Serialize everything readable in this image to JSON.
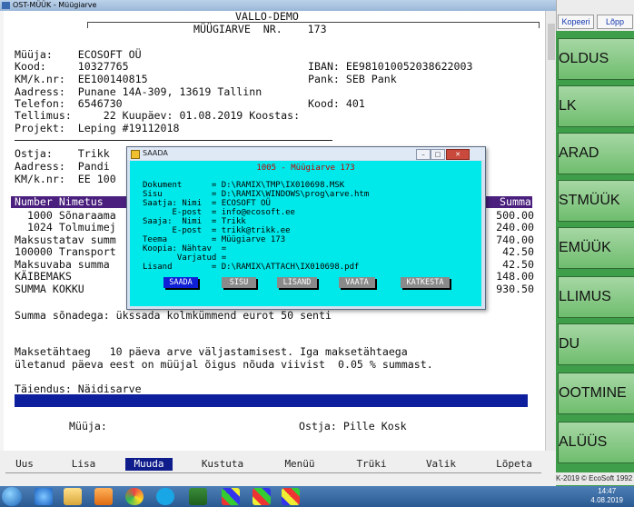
{
  "window": {
    "title": "OST-MÜÜK - Müügiarve"
  },
  "document": {
    "company_title": "VALLO-DEMO",
    "invoice_title": "MÜÜGIARVE  NR.    173",
    "seller": {
      "muuja": "Müüja:    ECOSOFT OÜ",
      "kood": "Kood:     10327765",
      "kmk": "KM/k.nr:  EE100140815",
      "aadress": "Aadress:  Punane 14A-309, 13619 Tallinn",
      "telefon": "Telefon:  6546730",
      "tellimus": "Tellimus:     22 Kuupäev: 01.08.2019 Koostas:",
      "projekt": "Projekt:  Leping #19112018"
    },
    "bank": {
      "iban": "IBAN: EE981010052038622003",
      "pank": "Pank: SEB Pank",
      "kood": "Kood: 401"
    },
    "buyer": {
      "ostja": "Ostja:    Trikk",
      "aadress": "Aadress:  Pandi",
      "kmk": "KM/k.nr:  EE 100"
    },
    "table_header_left": "Number Nimetus",
    "table_header_right": "Summa",
    "rows_left": [
      "  1000 Sõnaraama",
      "  1024 Tolmuimej",
      "Maksustatav summ",
      "100000 Transport",
      "Maksuvaba summa",
      "KÄIBEMAKS",
      "SUMMA KOKKU"
    ],
    "rows_right": [
      "500.00",
      "240.00",
      "740.00",
      "42.50",
      "42.50",
      "148.00",
      "930.50"
    ],
    "words_line": "Summa sõnadega: ükssada kolmkümmend eurot 50 senti",
    "payment_line1": "Maksetähtaeg   10 päeva arve väljastamisest. Iga maksetähtaega",
    "payment_line2": "ületanud päeva eest on müüjal õigus nõuda viivist  0.05 % summast.",
    "taiendus": "Täiendus: Näidisarve",
    "sign_seller": "Müüja:",
    "sign_buyer": "Ostja: Pille Kosk"
  },
  "function_keys": [
    "Uus",
    "Lisa",
    "Muuda",
    "Kustuta",
    "Menüü",
    "Trüki",
    "Valik",
    "Lõpeta"
  ],
  "function_key_selected": "Muuda",
  "side_panel": {
    "top_buttons": [
      "Kopeeri",
      "Lõpp"
    ],
    "buttons": [
      "OLDUS",
      "LK",
      "ARAD",
      "STMÜÜK",
      "EMÜÜK",
      "LLIMUS",
      "DU",
      "OOTMINE",
      "ALÜÜS"
    ],
    "copyright": "K-2019 © EcoSoft 1992"
  },
  "dialog": {
    "window_title": "SAADA",
    "title": "1005 - Müügiarve 173",
    "lines": [
      "Dokument      = D:\\RAMIX\\TMP\\IX010698.MSK",
      "Sisu          = D:\\RAMIX\\WINDOWS\\prog\\arve.htm",
      "Saatja: Nimi  = ECOSOFT OÜ",
      "      E-post  = info@ecosoft.ee",
      "Saaja:  Nimi  = Trikk",
      "      E-post  = trikk@trikk.ee",
      "Teema         = Müügiarve 173",
      "Koopia: Nähtav  =",
      "       Varjatud =",
      "Lisand        = D:\\RAMIX\\ATTACH\\IX010698.pdf"
    ],
    "buttons": [
      "SAADA",
      "SISU",
      "LISAND",
      "VAATA",
      "KATKESTA"
    ],
    "selected_button": "SAADA",
    "window_controls": [
      "minimize",
      "maximize",
      "close"
    ]
  },
  "taskbar": {
    "icons": [
      "start-orb",
      "ie-icon",
      "folder-icon",
      "media-icon",
      "chrome-icon",
      "skype-icon",
      "app-icon-1",
      "app-icon-2",
      "app-icon-3",
      "app-icon-4"
    ],
    "time": "14:47",
    "date": "4.08.2019"
  },
  "colors": {
    "table_header": "#4a1f7d",
    "blue_bar": "#0d1f9c",
    "side_panel": "#6fbd6e",
    "dialog_body": "#00e9ea",
    "dialog_title_text": "#c20000",
    "selected_button": "#0e1fd6"
  }
}
